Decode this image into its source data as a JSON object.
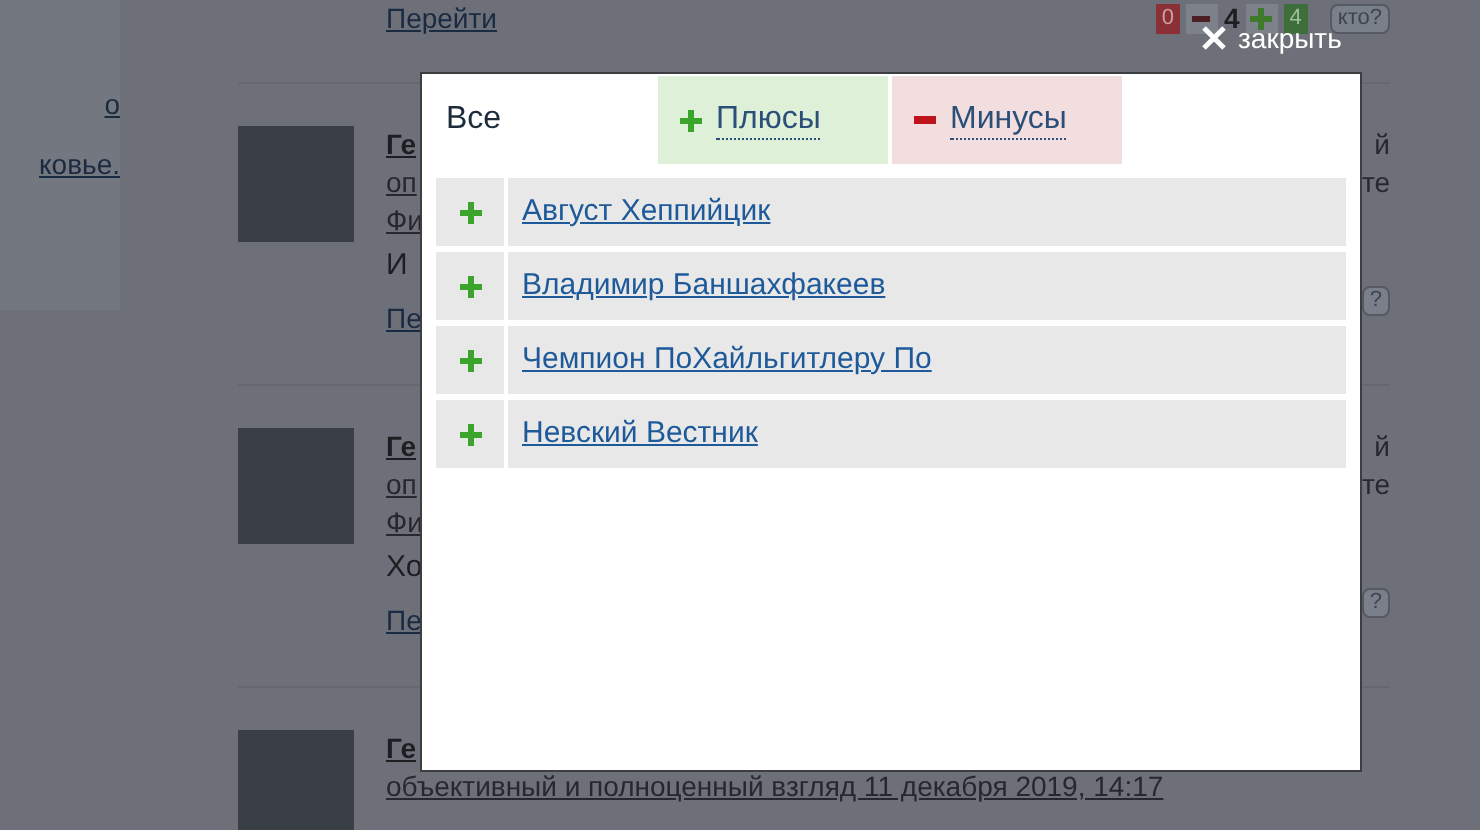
{
  "sidebar": {
    "texts": [
      "о",
      "ковье."
    ]
  },
  "top": {
    "link": "Перейти",
    "votes": {
      "minus_count": "0",
      "score": "4",
      "plus_count": "4",
      "who_button": "кто?"
    }
  },
  "close_button": {
    "label": "закрыть"
  },
  "comments": [
    {
      "author": "Ге",
      "meta": [
        "оп",
        "Фи"
      ],
      "body": "И",
      "link": "Пе",
      "meta_right": [
        "й",
        "те"
      ],
      "who_button": "?"
    },
    {
      "author": "Ге",
      "meta": [
        "оп",
        "Фи"
      ],
      "body": "Хо",
      "link": "Пе",
      "meta_right": [
        "й",
        "те"
      ],
      "who_button": "?"
    },
    {
      "author": "Ге",
      "meta": [
        "объективный и полноценный взгляд 11 декабря 2019, 14:17"
      ]
    }
  ],
  "modal": {
    "tabs": [
      {
        "label": "Все",
        "kind": "all",
        "selected": true
      },
      {
        "label": "Плюсы",
        "kind": "plus",
        "selected": false
      },
      {
        "label": "Минусы",
        "kind": "minus",
        "selected": false
      }
    ],
    "voters": [
      {
        "name": "Август Хеппийцик",
        "kind": "plus"
      },
      {
        "name": "Владимир Баншахфакеев",
        "kind": "plus"
      },
      {
        "name": "Чемпион ПоХайльгитлеру По",
        "kind": "plus"
      },
      {
        "name": "Невский Вестник",
        "kind": "plus"
      }
    ]
  }
}
